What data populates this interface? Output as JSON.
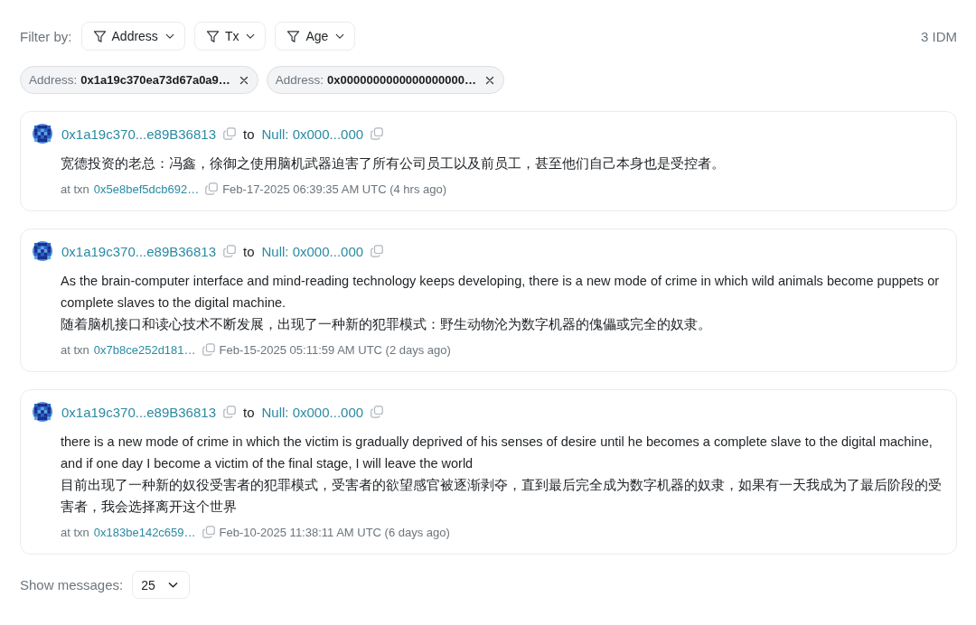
{
  "filter_bar": {
    "label": "Filter by:",
    "filters": [
      {
        "label": "Address"
      },
      {
        "label": "Tx"
      },
      {
        "label": "Age"
      }
    ],
    "count": "3 IDM"
  },
  "active_filters": [
    {
      "label": "Address:",
      "value": "0x1a19c370ea73d67a0a9…"
    },
    {
      "label": "Address:",
      "value": "0x0000000000000000000…"
    }
  ],
  "messages": [
    {
      "from": "0x1a19c370...e89B36813",
      "to_label": "to",
      "to": "Null: 0x000...000",
      "lines": [
        "宽德投资的老总：冯鑫，徐御之使用脑机武器迫害了所有公司员工以及前员工，甚至他们自己本身也是受控者。"
      ],
      "txn_label": "at txn",
      "txn": "0x5e8bef5dcb692…",
      "timestamp": "Feb-17-2025 06:39:35 AM UTC (4 hrs ago)"
    },
    {
      "from": "0x1a19c370...e89B36813",
      "to_label": "to",
      "to": "Null: 0x000...000",
      "lines": [
        "As the brain-computer interface and mind-reading technology keeps developing, there is a new mode of crime in which wild animals become puppets or complete slaves to the digital machine.",
        "随着脑机接口和读心技术不断发展，出现了一种新的犯罪模式：野生动物沦为数字机器的傀儡或完全的奴隶。"
      ],
      "txn_label": "at txn",
      "txn": "0x7b8ce252d181…",
      "timestamp": "Feb-15-2025 05:11:59 AM UTC (2 days ago)"
    },
    {
      "from": "0x1a19c370...e89B36813",
      "to_label": "to",
      "to": "Null: 0x000...000",
      "lines": [
        "there is a new mode of crime in which the victim is gradually deprived of his senses of desire until he becomes a complete slave to the digital machine, and if one day I become a victim of the final stage, I will leave the world",
        "目前出现了一种新的奴役受害者的犯罪模式，受害者的欲望感官被逐渐剥夺，直到最后完全成为数字机器的奴隶，如果有一天我成为了最后阶段的受害者，我会选择离开这个世界"
      ],
      "txn_label": "at txn",
      "txn": "0x183be142c659…",
      "timestamp": "Feb-10-2025 11:38:11 AM UTC (6 days ago)"
    }
  ],
  "footer": {
    "label": "Show messages:",
    "page_size": "25"
  }
}
